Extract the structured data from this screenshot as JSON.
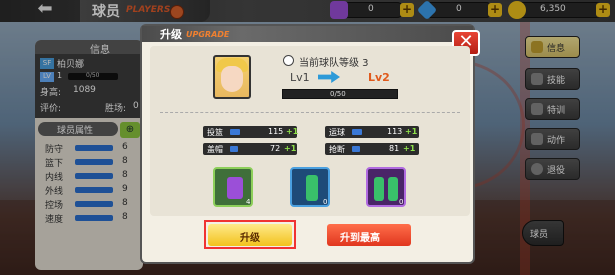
{
  "header": {
    "back_icon": "back-arrow-icon",
    "title": "球员",
    "subtitle": "PLAYERS"
  },
  "resources": [
    {
      "name": "card",
      "value": "0",
      "color": "#9b4fd8"
    },
    {
      "name": "diamond",
      "value": "0",
      "color": "#3ea0f0"
    },
    {
      "name": "coin",
      "value": "6,350",
      "color": "#f2c21d"
    }
  ],
  "info_panel": {
    "title": "信息",
    "position": "SF",
    "player_name": "柏贝娜",
    "level_label": "LV",
    "level": "1",
    "level_progress": "0/50",
    "height_label": "身高:",
    "height_value": "1089",
    "rating_label": "评价:",
    "wins_label": "胜场:",
    "wins_value": "0",
    "attr_title": "球员属性",
    "attrs": [
      {
        "label": "防守",
        "value": "6"
      },
      {
        "label": "篮下",
        "value": "8"
      },
      {
        "label": "内线",
        "value": "8"
      },
      {
        "label": "外线",
        "value": "9"
      },
      {
        "label": "控场",
        "value": "8"
      },
      {
        "label": "速度",
        "value": "8"
      }
    ]
  },
  "side_menu": [
    {
      "label": "信息",
      "active": true
    },
    {
      "label": "技能",
      "active": false
    },
    {
      "label": "特训",
      "active": false
    },
    {
      "label": "动作",
      "active": false
    },
    {
      "label": "退役",
      "active": false
    }
  ],
  "bottom_right": {
    "label": "球员"
  },
  "dialog": {
    "title": "升级",
    "subtitle": "UPGRADE",
    "close_icon": "close-icon",
    "team_level_text": "当前球队等级 3",
    "level_from": "Lv1",
    "level_to": "Lv2",
    "xp_text": "0/50",
    "xp_fraction": 0,
    "stats": [
      {
        "name": "投篮",
        "value": "115",
        "plus": "+1"
      },
      {
        "name": "运球",
        "value": "113",
        "plus": "+1"
      },
      {
        "name": "盖帽",
        "value": "72",
        "plus": "+1"
      },
      {
        "name": "抢断",
        "value": "81",
        "plus": "+1"
      }
    ],
    "items": [
      {
        "icon": "purple-can-icon",
        "count": "4"
      },
      {
        "icon": "sports-drink-icon",
        "count": "0"
      },
      {
        "icon": "drink-bottles-icon",
        "count": "0"
      }
    ],
    "upgrade_button": "升级",
    "max_button": "升到最高"
  }
}
